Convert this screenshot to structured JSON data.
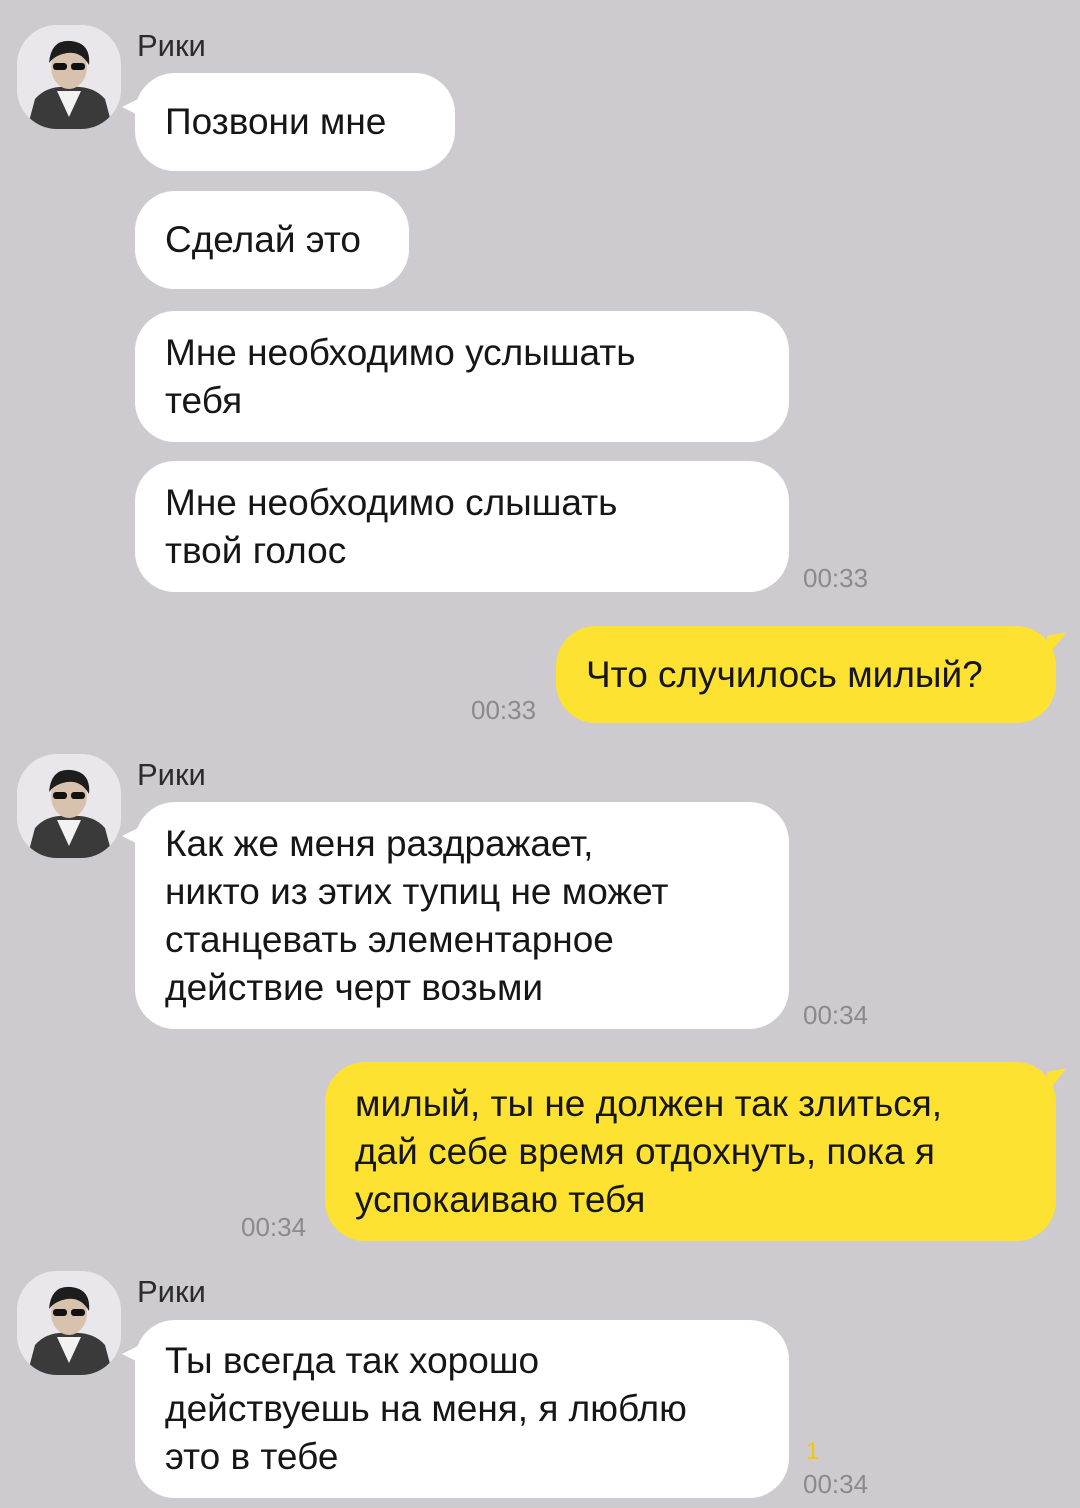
{
  "messages": [
    {
      "sender": "Рики",
      "text": "Позвони мне"
    },
    {
      "text": "Сделай это"
    },
    {
      "text": "Мне необходимо услышать\nтебя"
    },
    {
      "text": "Мне необходимо слышать\nтвой голос",
      "time": "00:33"
    },
    {
      "outgoing": true,
      "text": "Что случилось милый?",
      "time": "00:33"
    },
    {
      "sender": "Рики",
      "text": "Как же меня раздражает,\nникто из этих тупиц не может\nстанцевать элементарное\nдействие черт возьми",
      "time": "00:34"
    },
    {
      "outgoing": true,
      "text": "милый, ты не должен так злиться,\nдай себе время отдохнуть, пока я\nуспокаиваю тебя",
      "time": "00:34"
    },
    {
      "sender": "Рики",
      "text": "Ты всегда так хорошо\nдействуешь на меня, я люблю\nэто в тебе",
      "time": "00:34",
      "unread": "1"
    }
  ],
  "colors": {
    "background": "#cdcbd0",
    "incoming": "#ffffff",
    "outgoing": "#fde232",
    "time": "#8a8a8e",
    "unread": "#f2c800"
  }
}
